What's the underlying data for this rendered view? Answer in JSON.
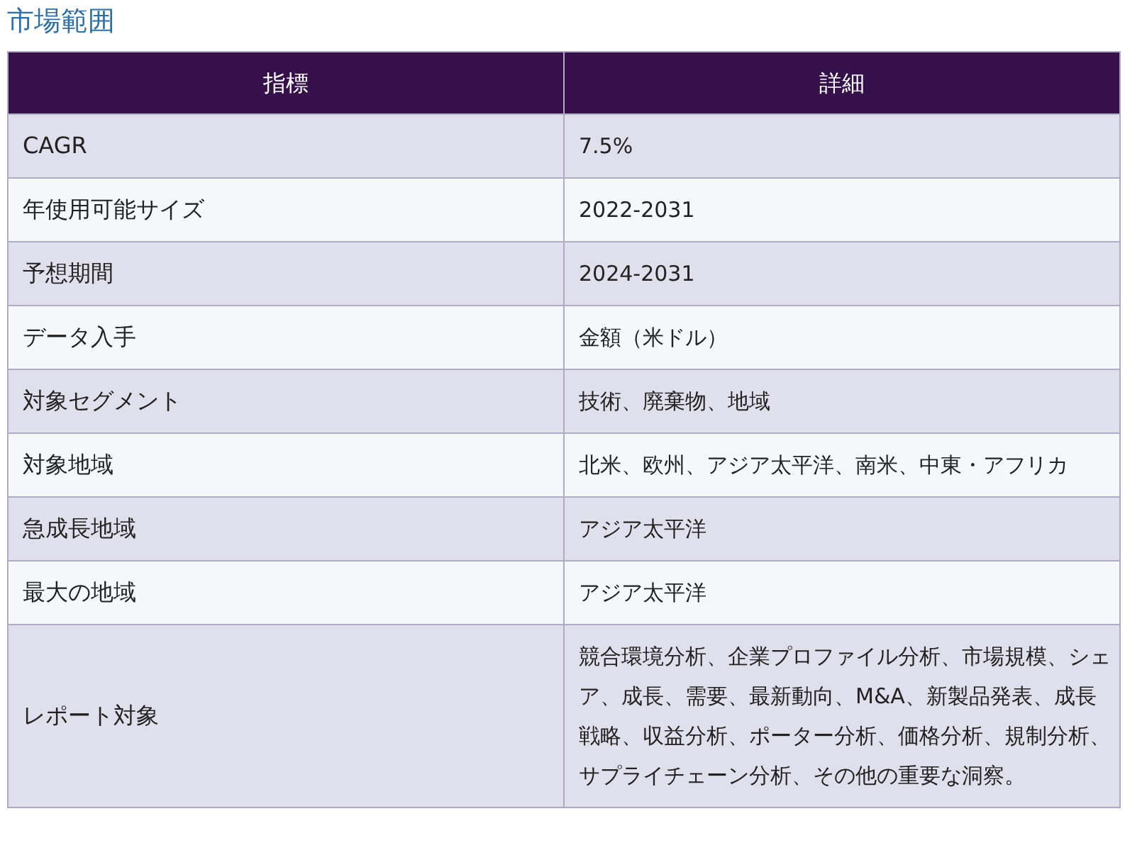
{
  "title": "市場範囲",
  "table": {
    "columns": [
      "指標",
      "詳細"
    ],
    "rows": [
      {
        "metric": "CAGR",
        "detail": "7.5%"
      },
      {
        "metric": "年使用可能サイズ",
        "detail": "2022-2031"
      },
      {
        "metric": "予想期間",
        "detail": "2024-2031"
      },
      {
        "metric": "データ入手",
        "detail": "金額（米ドル）"
      },
      {
        "metric": "対象セグメント",
        "detail": "技術、廃棄物、地域"
      },
      {
        "metric": "対象地域",
        "detail": "北米、欧州、アジア太平洋、南米、中東・アフリカ"
      },
      {
        "metric": "急成長地域",
        "detail": "アジア太平洋"
      },
      {
        "metric": "最大の地域",
        "detail": "アジア太平洋"
      },
      {
        "metric": "レポート対象",
        "detail": "競合環境分析、企業プロファイル分析、市場規模、シェア、成長、需要、最新動向、M&A、新製品発表、成長戦略、収益分析、ポーター分析、価格分析、規制分析、サプライチェーン分析、その他の重要な洞察。"
      }
    ]
  }
}
